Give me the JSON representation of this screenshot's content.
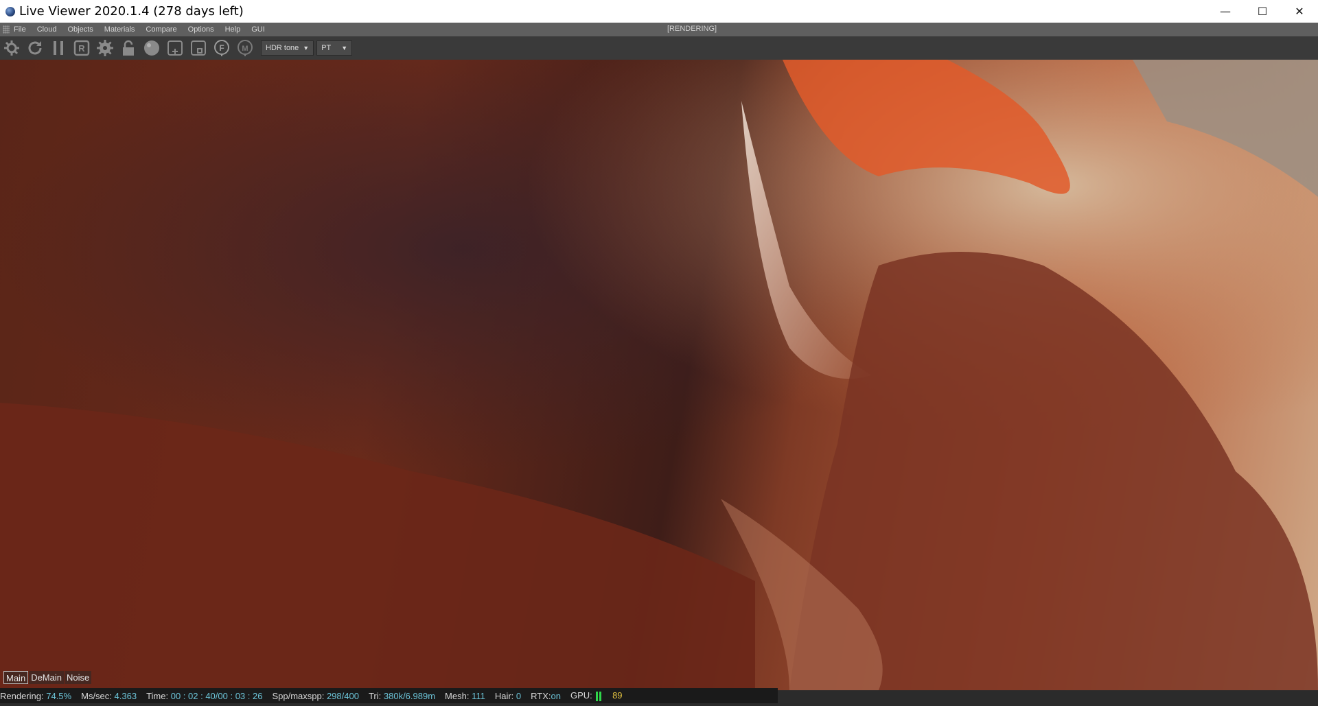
{
  "window": {
    "title": "Live Viewer 2020.1.4 (278 days left)",
    "controls": {
      "minimize": "—",
      "maximize": "☐",
      "close": "✕"
    }
  },
  "menu": {
    "items": [
      "File",
      "Cloud",
      "Objects",
      "Materials",
      "Compare",
      "Options",
      "Help",
      "GUI"
    ],
    "status": "[RENDERING]"
  },
  "toolbar": {
    "icons": [
      "settings-gear-icon",
      "refresh-icon",
      "pause-icon",
      "region-render-icon",
      "gear-icon",
      "lock-icon",
      "sphere-icon",
      "add-box-icon",
      "box-icon",
      "focus-pick-icon",
      "material-pick-icon"
    ],
    "tonemap_select": "HDR tone",
    "kernel_select": "PT"
  },
  "tabs": [
    "Main",
    "DeMain",
    "Noise"
  ],
  "status": {
    "rendering_label": "Rendering:",
    "rendering_value": "74.5%",
    "ms_label": "Ms/sec:",
    "ms_value": "4.363",
    "time_label": "Time:",
    "time_value": "00 : 02 : 40/00 : 03 : 26",
    "spp_label": "Spp/maxspp:",
    "spp_value": "298/400",
    "tri_label": "Tri:",
    "tri_value": "380k/6.989m",
    "mesh_label": "Mesh:",
    "mesh_value": "111",
    "hair_label": "Hair:",
    "hair_value": "0",
    "rtx_label": "RTX:",
    "rtx_value": "on",
    "gpu_label": "GPU:",
    "gpu_temp": "89"
  },
  "colors": {
    "accent_value": "#6cc4d8",
    "gpu_green": "#2fd64a",
    "gpu_temp": "#e0c040"
  }
}
